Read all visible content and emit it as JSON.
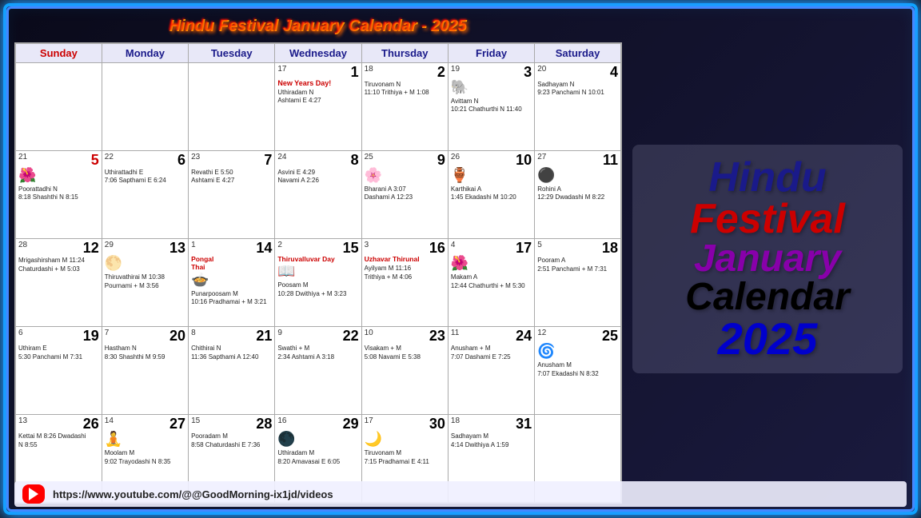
{
  "title": "Hindu Festival January Calendar - 2025",
  "days_header": [
    "Sunday",
    "Monday",
    "Tuesday",
    "Wednesday",
    "Thursday",
    "Friday",
    "Saturday"
  ],
  "right": {
    "line1": "Hindu",
    "line2": "Festival",
    "line3": "January",
    "line4": "Calendar",
    "line5": "2025"
  },
  "footer": {
    "url": "https://www.youtube.com/@@GoodMorning-ix1jd/videos"
  },
  "weeks": [
    [
      {
        "date": "",
        "num": "",
        "events": []
      },
      {
        "date": "",
        "num": "",
        "events": []
      },
      {
        "date": "",
        "num": "",
        "events": []
      },
      {
        "date": "17",
        "num": "1",
        "highlight": "New Years Day!",
        "events": [
          "Uthiradam N",
          "Ashtami E 4:27"
        ],
        "special": "new-years"
      },
      {
        "date": "18",
        "num": "2",
        "events": [
          "Tiruvonam N",
          "11:10 Trithiya + M 1:08"
        ]
      },
      {
        "date": "19",
        "num": "3",
        "icon": "🐘",
        "events": [
          "Avittam N",
          "10:21 Chathurthi N 11:40"
        ]
      },
      {
        "date": "20",
        "num": "4",
        "events": [
          "Sadhayam N",
          "9:23 Panchami N 10:01"
        ]
      }
    ],
    [
      {
        "date": "21",
        "num": "5",
        "icon": "🌺",
        "events": [
          "Poorattadhi N",
          "8:18 Shashthi N 8:15"
        ],
        "num_red": true
      },
      {
        "date": "22",
        "num": "6",
        "events": [
          "Uthirattadhi E",
          "7:06 Sapthami E 6:24"
        ]
      },
      {
        "date": "23",
        "num": "7",
        "events": [
          "Revathi E 5:50",
          "Ashtami E 4:27"
        ]
      },
      {
        "date": "24",
        "num": "8",
        "events": [
          "Asvini E 4:29",
          "Navami A 2:26"
        ]
      },
      {
        "date": "25",
        "num": "9",
        "icon": "🌸",
        "events": [
          "Bharani A 3:07",
          "Dashami A 12:23"
        ]
      },
      {
        "date": "26",
        "num": "10",
        "icon": "🏺",
        "events": [
          "Karthikai A",
          "1:45 Ekadashi M 10:20"
        ]
      },
      {
        "date": "27",
        "num": "11",
        "icon": "⚫",
        "events": [
          "Rohini A",
          "12:29 Dwadashi M 8:22"
        ]
      }
    ],
    [
      {
        "date": "28",
        "num": "12",
        "events": [
          "Mrigashirsham M 11:24",
          "Chaturdashi + M 5:03"
        ]
      },
      {
        "date": "29",
        "num": "13",
        "icon": "🌕",
        "events": [
          "Thiruvathirai M 10:38",
          "Pournami + M 3:56"
        ]
      },
      {
        "date": "1",
        "num": "14",
        "special_label": "Pongal\nThai",
        "icon": "🍲",
        "events": [
          "Punarpoosam M",
          "10:16 Pradhamai + M 3:21"
        ],
        "pongal": true
      },
      {
        "date": "2",
        "num": "15",
        "special_label": "Thiruvalluvar Day",
        "icon": "📖",
        "events": [
          "Poosam M",
          "10:28 Dwithiya + M 3:23"
        ]
      },
      {
        "date": "3",
        "num": "16",
        "special_label": "Uzhavar Thirunal",
        "events": [
          "Ayilyam M 11:16",
          "Trithiya + M 4:06"
        ]
      },
      {
        "date": "4",
        "num": "17",
        "icon": "🌺",
        "events": [
          "Makam A",
          "12:44 Chathurthi + M 5:30"
        ]
      },
      {
        "date": "5",
        "num": "18",
        "events": [
          "Pooram A",
          "2:51 Panchami + M 7:31"
        ]
      }
    ],
    [
      {
        "date": "6",
        "num": "19",
        "events": [
          "Uthiram E",
          "5:30 Panchami M 7:31"
        ]
      },
      {
        "date": "7",
        "num": "20",
        "events": [
          "Hastham N",
          "8:30 Shashthi M 9:59"
        ]
      },
      {
        "date": "8",
        "num": "21",
        "events": [
          "Chithirai N",
          "11:36 Sapthami A 12:40"
        ]
      },
      {
        "date": "9",
        "num": "22",
        "events": [
          "Swathi + M",
          "2:34 Ashtami A 3:18"
        ]
      },
      {
        "date": "10",
        "num": "23",
        "events": [
          "Visakam + M",
          "5:08 Navami E 5:38"
        ]
      },
      {
        "date": "11",
        "num": "24",
        "events": [
          "Anusham + M",
          "7:07 Dashami E 7:25"
        ]
      },
      {
        "date": "12",
        "num": "25",
        "icon": "🌀",
        "events": [
          "Anusham M",
          "7:07 Ekadashi N 8:32"
        ]
      }
    ],
    [
      {
        "date": "13",
        "num": "26",
        "events": [
          "Kettai M 8:26 Dwadashi",
          "N 8:55"
        ]
      },
      {
        "date": "14",
        "num": "27",
        "icon": "🧘",
        "events": [
          "Moolam M",
          "9:02 Trayodashi N 8:35"
        ]
      },
      {
        "date": "15",
        "num": "28",
        "events": [
          "Pooradam M",
          "8:58 Chaturdashi E 7:36"
        ]
      },
      {
        "date": "16",
        "num": "29",
        "icon": "🌑",
        "events": [
          "Uthiradam M",
          "8:20 Amavasai E 6:05"
        ]
      },
      {
        "date": "17",
        "num": "30",
        "icon": "🌙",
        "events": [
          "Tiruvonam M",
          "7:15 Pradhamai E 4:11"
        ]
      },
      {
        "date": "18",
        "num": "31",
        "events": [
          "Sadhayam M",
          "4:14 Dwithiya A 1:59"
        ]
      },
      {
        "date": "",
        "num": "",
        "events": []
      }
    ]
  ]
}
